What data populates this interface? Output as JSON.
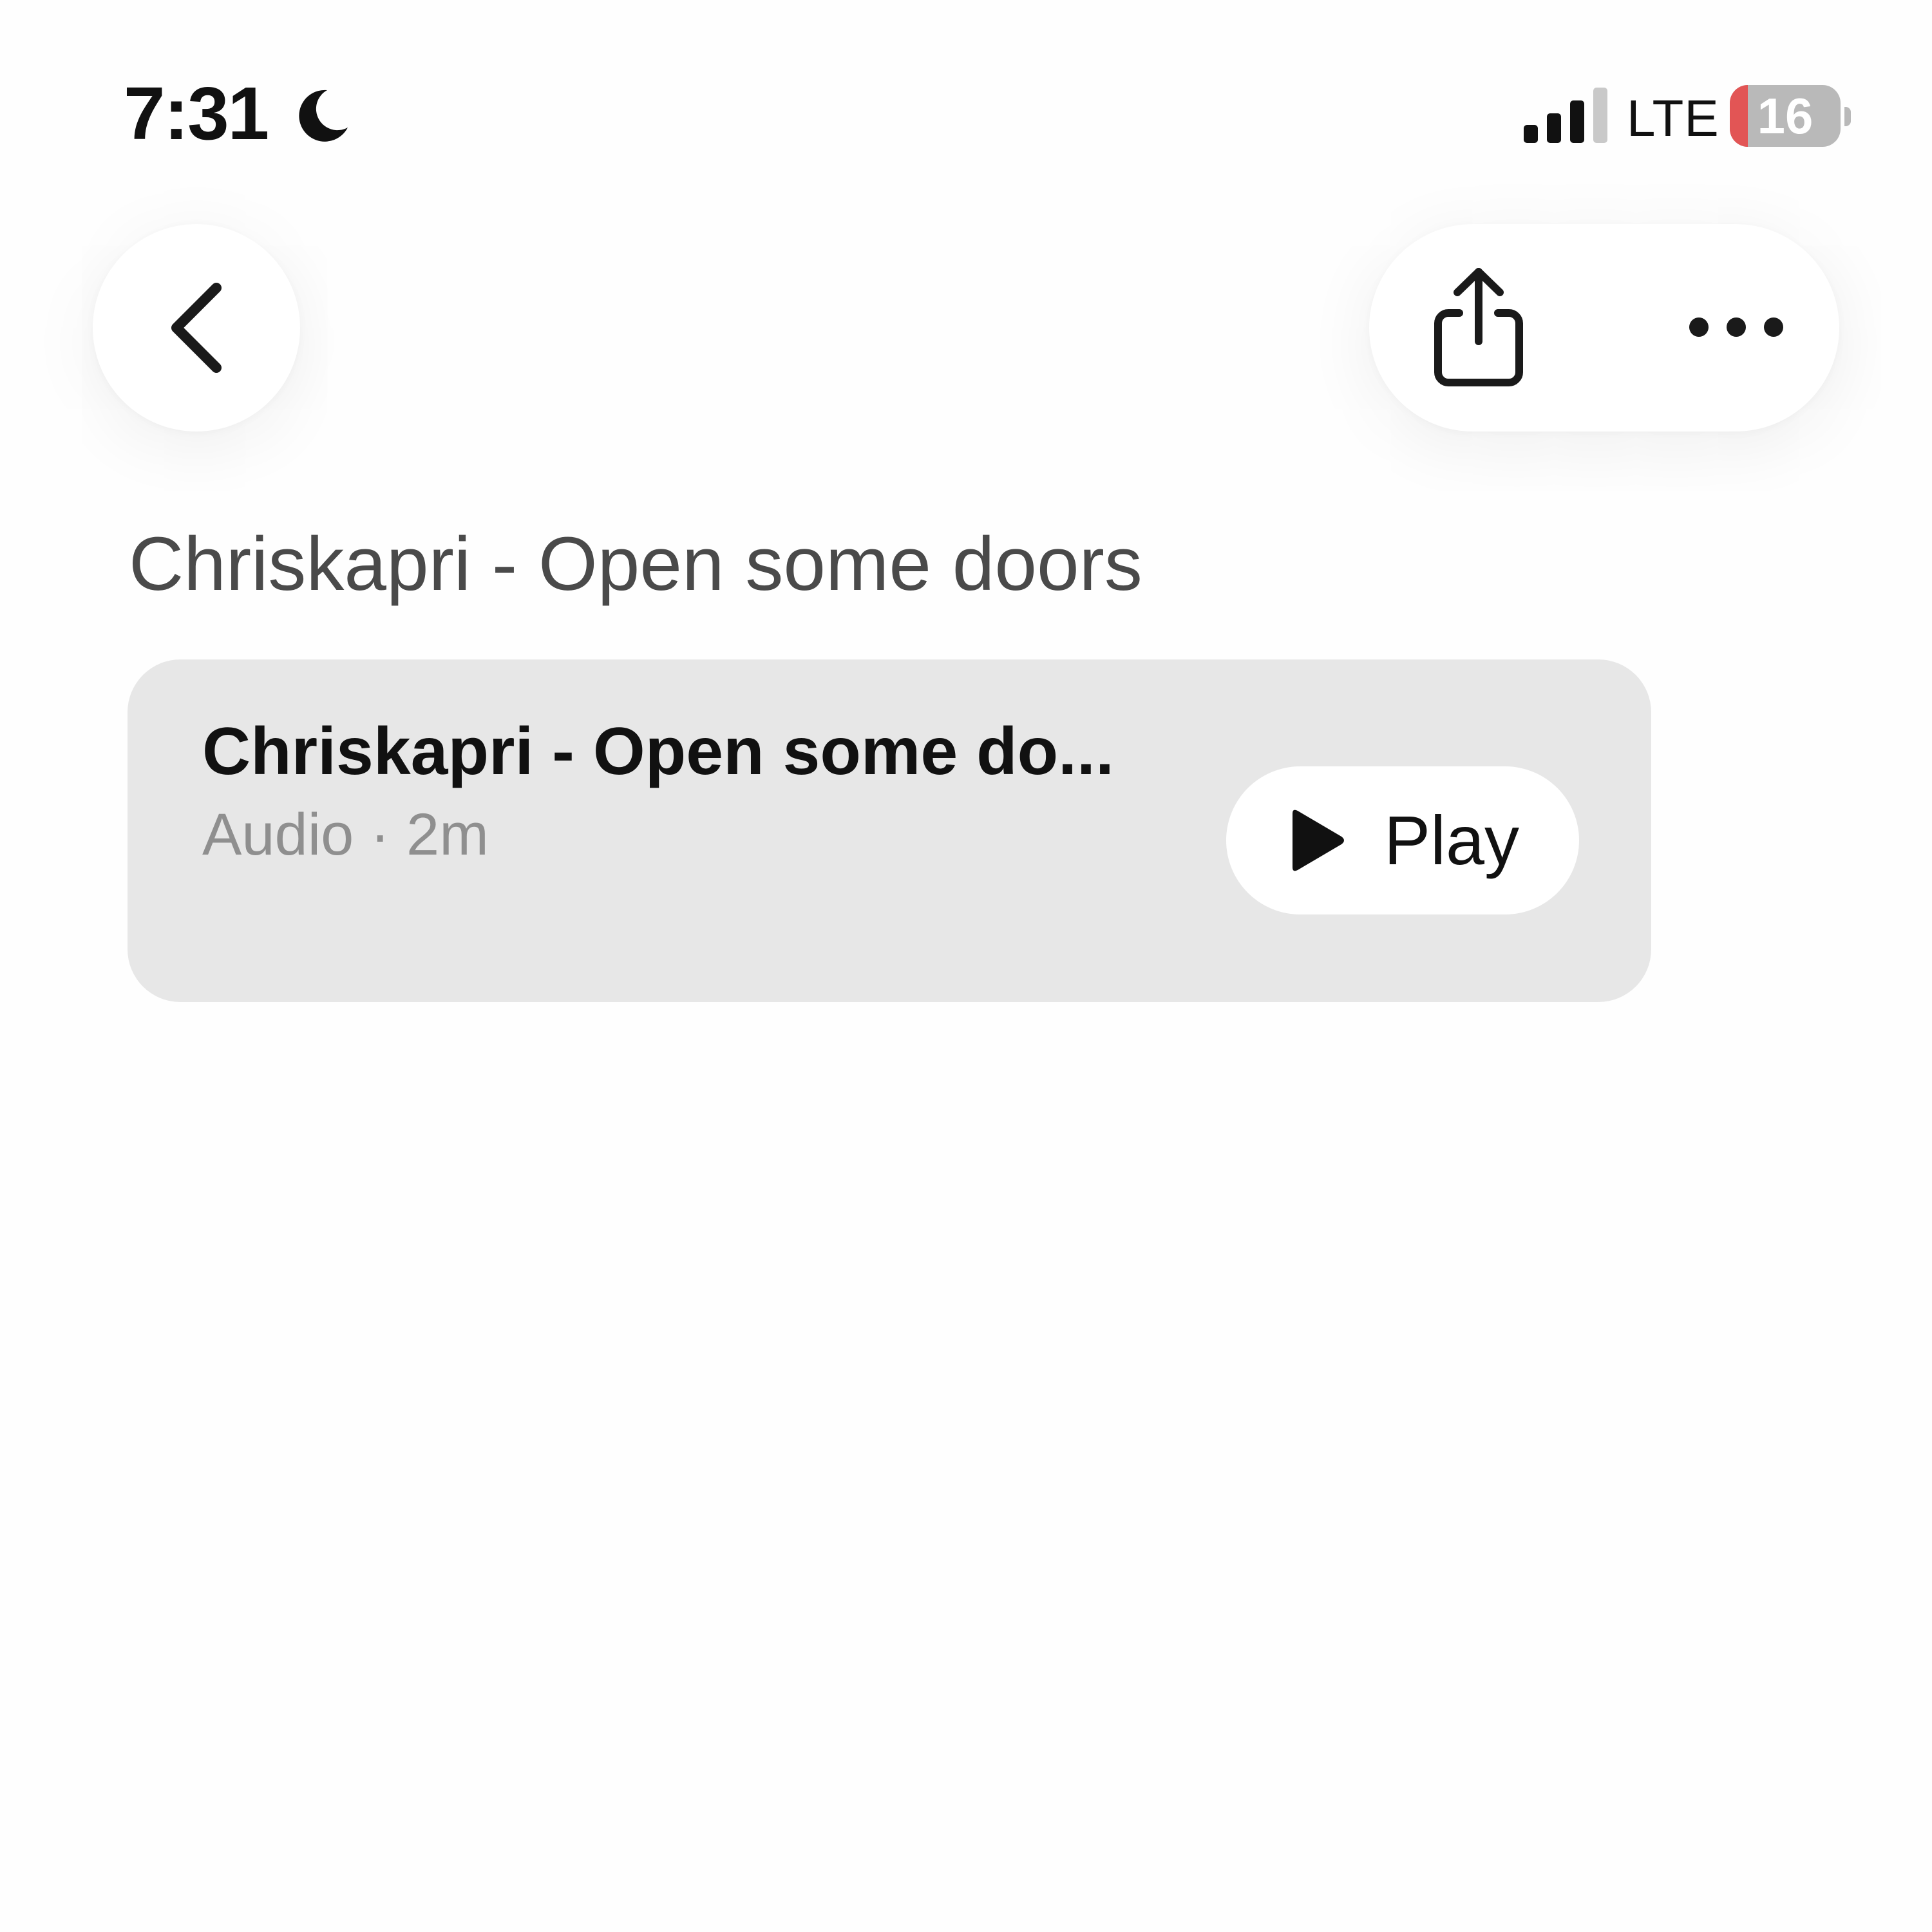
{
  "status_bar": {
    "time": "7:31",
    "focus_icon": "moon-icon",
    "signal_icon": "cellular-signal-icon",
    "signal_bars_active": 3,
    "signal_bars_total": 4,
    "network": "LTE",
    "battery_percent": "16",
    "battery_level": 0.16,
    "battery_low_color": "#e25555"
  },
  "nav": {
    "back_icon": "chevron-left-icon",
    "share_icon": "share-icon",
    "more_icon": "ellipsis-icon"
  },
  "page": {
    "title": "Chriskapri - Open some doors"
  },
  "audio_card": {
    "title": "Chriskapri - Open some do...",
    "meta": "Audio · 2m",
    "play_icon": "play-icon",
    "play_label": "Play"
  },
  "colors": {
    "background": "#fefefe",
    "card_background": "#e7e7e7",
    "text_primary": "#111111",
    "text_secondary": "#8f8f8f",
    "title_text": "#4a4a4a"
  }
}
